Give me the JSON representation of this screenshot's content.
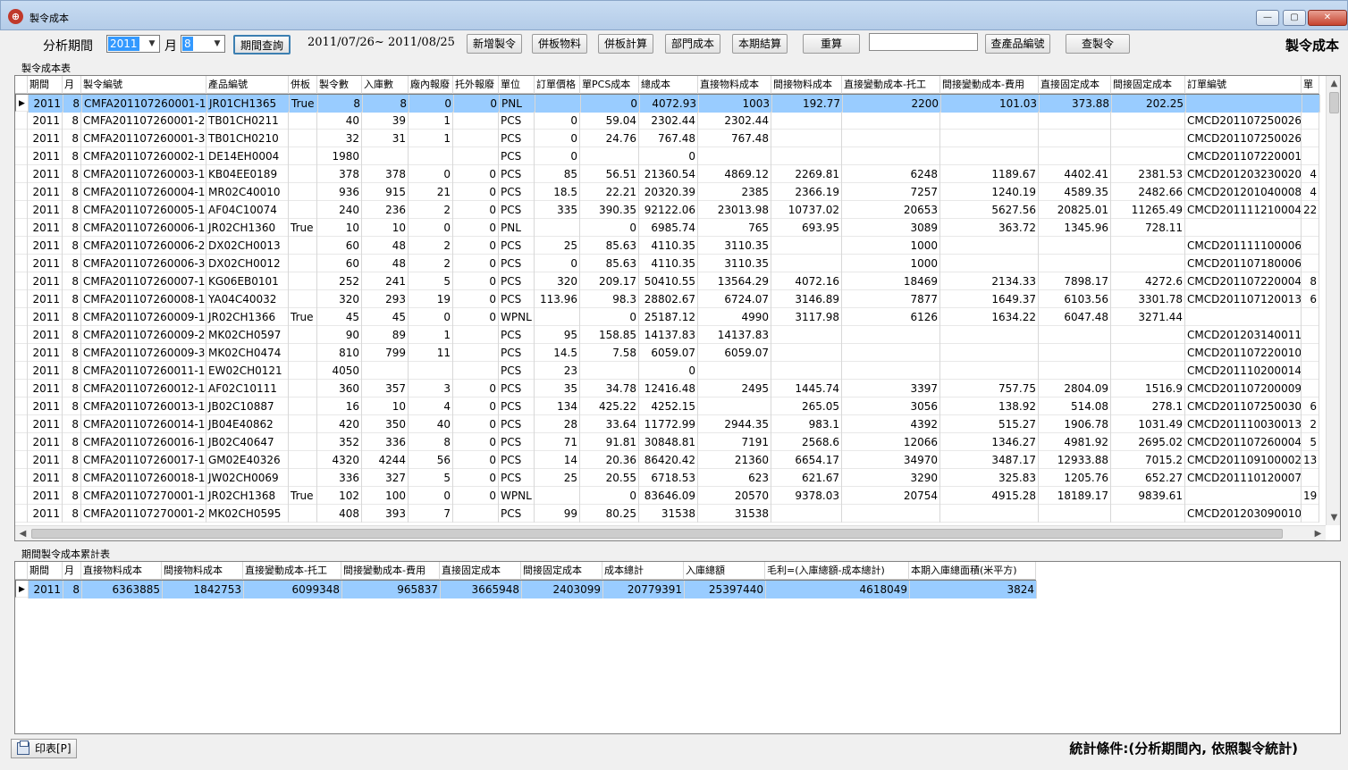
{
  "window": {
    "title": "製令成本",
    "form_title": "製令成本",
    "minimize": "—",
    "maximize": "▢",
    "close": "✕"
  },
  "toolbar": {
    "period_label": "分析期間",
    "year": "2011",
    "month_label": "月",
    "month": "8",
    "query_btn": "期間查詢",
    "date_range": "2011/07/26~ 2011/08/25",
    "new_order_btn": "新增製令",
    "board_material_btn": "併板物料",
    "board_calc_btn": "併板計算",
    "dept_cost_btn": "部門成本",
    "period_close_btn": "本期結算",
    "recalc_btn": "重算",
    "search_value": "",
    "product_search_btn": "查產品編號",
    "order_search_btn": "查製令"
  },
  "main_grid": {
    "group_title": "製令成本表",
    "columns": [
      "期間",
      "月",
      "製令編號",
      "產品編號",
      "併板",
      "製令數",
      "入庫數",
      "廠內報廢",
      "托外報廢",
      "單位",
      "訂單價格",
      "單PCS成本",
      "總成本",
      "直接物料成本",
      "間接物料成本",
      "直接變動成本-托工",
      "間接變動成本-費用",
      "直接固定成本",
      "間接固定成本",
      "訂單編號",
      "單"
    ],
    "rows": [
      [
        "2011",
        "8",
        "CMFA201107260001-1",
        "JR01CH1365",
        "True",
        "8",
        "8",
        "0",
        "0",
        "PNL",
        "",
        "0",
        "4072.93",
        "1003",
        "192.77",
        "2200",
        "101.03",
        "373.88",
        "202.25",
        "",
        ""
      ],
      [
        "2011",
        "8",
        "CMFA201107260001-2",
        "TB01CH0211",
        "",
        "40",
        "39",
        "1",
        "",
        "PCS",
        "0",
        "59.04",
        "2302.44",
        "2302.44",
        "",
        "",
        "",
        "",
        "",
        "CMCD201107250026",
        ""
      ],
      [
        "2011",
        "8",
        "CMFA201107260001-3",
        "TB01CH0210",
        "",
        "32",
        "31",
        "1",
        "",
        "PCS",
        "0",
        "24.76",
        "767.48",
        "767.48",
        "",
        "",
        "",
        "",
        "",
        "CMCD201107250026",
        ""
      ],
      [
        "2011",
        "8",
        "CMFA201107260002-1",
        "DE14EH0004",
        "",
        "1980",
        "",
        "",
        "",
        "PCS",
        "0",
        "",
        "0",
        "",
        "",
        "",
        "",
        "",
        "",
        "CMCD201107220001",
        ""
      ],
      [
        "2011",
        "8",
        "CMFA201107260003-1",
        "KB04EE0189",
        "",
        "378",
        "378",
        "0",
        "0",
        "PCS",
        "85",
        "56.51",
        "21360.54",
        "4869.12",
        "2269.81",
        "6248",
        "1189.67",
        "4402.41",
        "2381.53",
        "CMCD201203230020",
        "4"
      ],
      [
        "2011",
        "8",
        "CMFA201107260004-1",
        "MR02C40010",
        "",
        "936",
        "915",
        "21",
        "0",
        "PCS",
        "18.5",
        "22.21",
        "20320.39",
        "2385",
        "2366.19",
        "7257",
        "1240.19",
        "4589.35",
        "2482.66",
        "CMCD201201040008",
        "4"
      ],
      [
        "2011",
        "8",
        "CMFA201107260005-1",
        "AF04C10074",
        "",
        "240",
        "236",
        "2",
        "0",
        "PCS",
        "335",
        "390.35",
        "92122.06",
        "23013.98",
        "10737.02",
        "20653",
        "5627.56",
        "20825.01",
        "11265.49",
        "CMCD201111210004",
        "22"
      ],
      [
        "2011",
        "8",
        "CMFA201107260006-1",
        "JR02CH1360",
        "True",
        "10",
        "10",
        "0",
        "0",
        "PNL",
        "",
        "0",
        "6985.74",
        "765",
        "693.95",
        "3089",
        "363.72",
        "1345.96",
        "728.11",
        "",
        ""
      ],
      [
        "2011",
        "8",
        "CMFA201107260006-2",
        "DX02CH0013",
        "",
        "60",
        "48",
        "2",
        "0",
        "PCS",
        "25",
        "85.63",
        "4110.35",
        "3110.35",
        "",
        "1000",
        "",
        "",
        "",
        "CMCD201111100006",
        ""
      ],
      [
        "2011",
        "8",
        "CMFA201107260006-3",
        "DX02CH0012",
        "",
        "60",
        "48",
        "2",
        "0",
        "PCS",
        "0",
        "85.63",
        "4110.35",
        "3110.35",
        "",
        "1000",
        "",
        "",
        "",
        "CMCD201107180006",
        ""
      ],
      [
        "2011",
        "8",
        "CMFA201107260007-1",
        "KG06EB0101",
        "",
        "252",
        "241",
        "5",
        "0",
        "PCS",
        "320",
        "209.17",
        "50410.55",
        "13564.29",
        "4072.16",
        "18469",
        "2134.33",
        "7898.17",
        "4272.6",
        "CMCD201107220004",
        "8"
      ],
      [
        "2011",
        "8",
        "CMFA201107260008-1",
        "YA04C40032",
        "",
        "320",
        "293",
        "19",
        "0",
        "PCS",
        "113.96",
        "98.3",
        "28802.67",
        "6724.07",
        "3146.89",
        "7877",
        "1649.37",
        "6103.56",
        "3301.78",
        "CMCD201107120013",
        "6"
      ],
      [
        "2011",
        "8",
        "CMFA201107260009-1",
        "JR02CH1366",
        "True",
        "45",
        "45",
        "0",
        "0",
        "WPNL",
        "",
        "0",
        "25187.12",
        "4990",
        "3117.98",
        "6126",
        "1634.22",
        "6047.48",
        "3271.44",
        "",
        ""
      ],
      [
        "2011",
        "8",
        "CMFA201107260009-2",
        "MK02CH0597",
        "",
        "90",
        "89",
        "1",
        "",
        "PCS",
        "95",
        "158.85",
        "14137.83",
        "14137.83",
        "",
        "",
        "",
        "",
        "",
        "CMCD201203140011",
        ""
      ],
      [
        "2011",
        "8",
        "CMFA201107260009-3",
        "MK02CH0474",
        "",
        "810",
        "799",
        "11",
        "",
        "PCS",
        "14.5",
        "7.58",
        "6059.07",
        "6059.07",
        "",
        "",
        "",
        "",
        "",
        "CMCD201107220010",
        ""
      ],
      [
        "2011",
        "8",
        "CMFA201107260011-1",
        "EW02CH0121",
        "",
        "4050",
        "",
        "",
        "",
        "PCS",
        "23",
        "",
        "0",
        "",
        "",
        "",
        "",
        "",
        "",
        "CMCD201110200014",
        ""
      ],
      [
        "2011",
        "8",
        "CMFA201107260012-1",
        "AF02C10111",
        "",
        "360",
        "357",
        "3",
        "0",
        "PCS",
        "35",
        "34.78",
        "12416.48",
        "2495",
        "1445.74",
        "3397",
        "757.75",
        "2804.09",
        "1516.9",
        "CMCD201107200009",
        ""
      ],
      [
        "2011",
        "8",
        "CMFA201107260013-1",
        "JB02C10887",
        "",
        "16",
        "10",
        "4",
        "0",
        "PCS",
        "134",
        "425.22",
        "4252.15",
        "",
        "265.05",
        "3056",
        "138.92",
        "514.08",
        "278.1",
        "CMCD201107250030",
        "6"
      ],
      [
        "2011",
        "8",
        "CMFA201107260014-1",
        "JB04E40862",
        "",
        "420",
        "350",
        "40",
        "0",
        "PCS",
        "28",
        "33.64",
        "11772.99",
        "2944.35",
        "983.1",
        "4392",
        "515.27",
        "1906.78",
        "1031.49",
        "CMCD201110030013",
        "2"
      ],
      [
        "2011",
        "8",
        "CMFA201107260016-1",
        "JB02C40647",
        "",
        "352",
        "336",
        "8",
        "0",
        "PCS",
        "71",
        "91.81",
        "30848.81",
        "7191",
        "2568.6",
        "12066",
        "1346.27",
        "4981.92",
        "2695.02",
        "CMCD201107260004",
        "5"
      ],
      [
        "2011",
        "8",
        "CMFA201107260017-1",
        "GM02E40326",
        "",
        "4320",
        "4244",
        "56",
        "0",
        "PCS",
        "14",
        "20.36",
        "86420.42",
        "21360",
        "6654.17",
        "34970",
        "3487.17",
        "12933.88",
        "7015.2",
        "CMCD201109100002",
        "13"
      ],
      [
        "2011",
        "8",
        "CMFA201107260018-1",
        "JW02CH0069",
        "",
        "336",
        "327",
        "5",
        "0",
        "PCS",
        "25",
        "20.55",
        "6718.53",
        "623",
        "621.67",
        "3290",
        "325.83",
        "1205.76",
        "652.27",
        "CMCD201110120007",
        ""
      ],
      [
        "2011",
        "8",
        "CMFA201107270001-1",
        "JR02CH1368",
        "True",
        "102",
        "100",
        "0",
        "0",
        "WPNL",
        "",
        "0",
        "83646.09",
        "20570",
        "9378.03",
        "20754",
        "4915.28",
        "18189.17",
        "9839.61",
        "",
        "19"
      ],
      [
        "2011",
        "8",
        "CMFA201107270001-2",
        "MK02CH0595",
        "",
        "408",
        "393",
        "7",
        "",
        "PCS",
        "99",
        "80.25",
        "31538",
        "31538",
        "",
        "",
        "",
        "",
        "",
        "CMCD201203090010",
        ""
      ]
    ],
    "selected_row": 0,
    "row_marker": "▶"
  },
  "summary_grid": {
    "group_title": "期間製令成本累計表",
    "columns": [
      "期間",
      "月",
      "直接物料成本",
      "間接物料成本",
      "直接變動成本-托工",
      "間接變動成本-費用",
      "直接固定成本",
      "間接固定成本",
      "成本總計",
      "入庫總額",
      "毛利=(入庫總額-成本總計)",
      "本期入庫總面積(米平方)"
    ],
    "rows": [
      [
        "2011",
        "8",
        "6363885",
        "1842753",
        "6099348",
        "965837",
        "3665948",
        "2403099",
        "20779391",
        "25397440",
        "4618049",
        "3824"
      ]
    ],
    "row_marker": "▶"
  },
  "footer": {
    "print_btn": "印表[P]",
    "condition": "統計條件:(分析期間內, 依照製令統計)"
  },
  "colors": {
    "selection": "#99ccff",
    "window_close": "#c7442f"
  }
}
